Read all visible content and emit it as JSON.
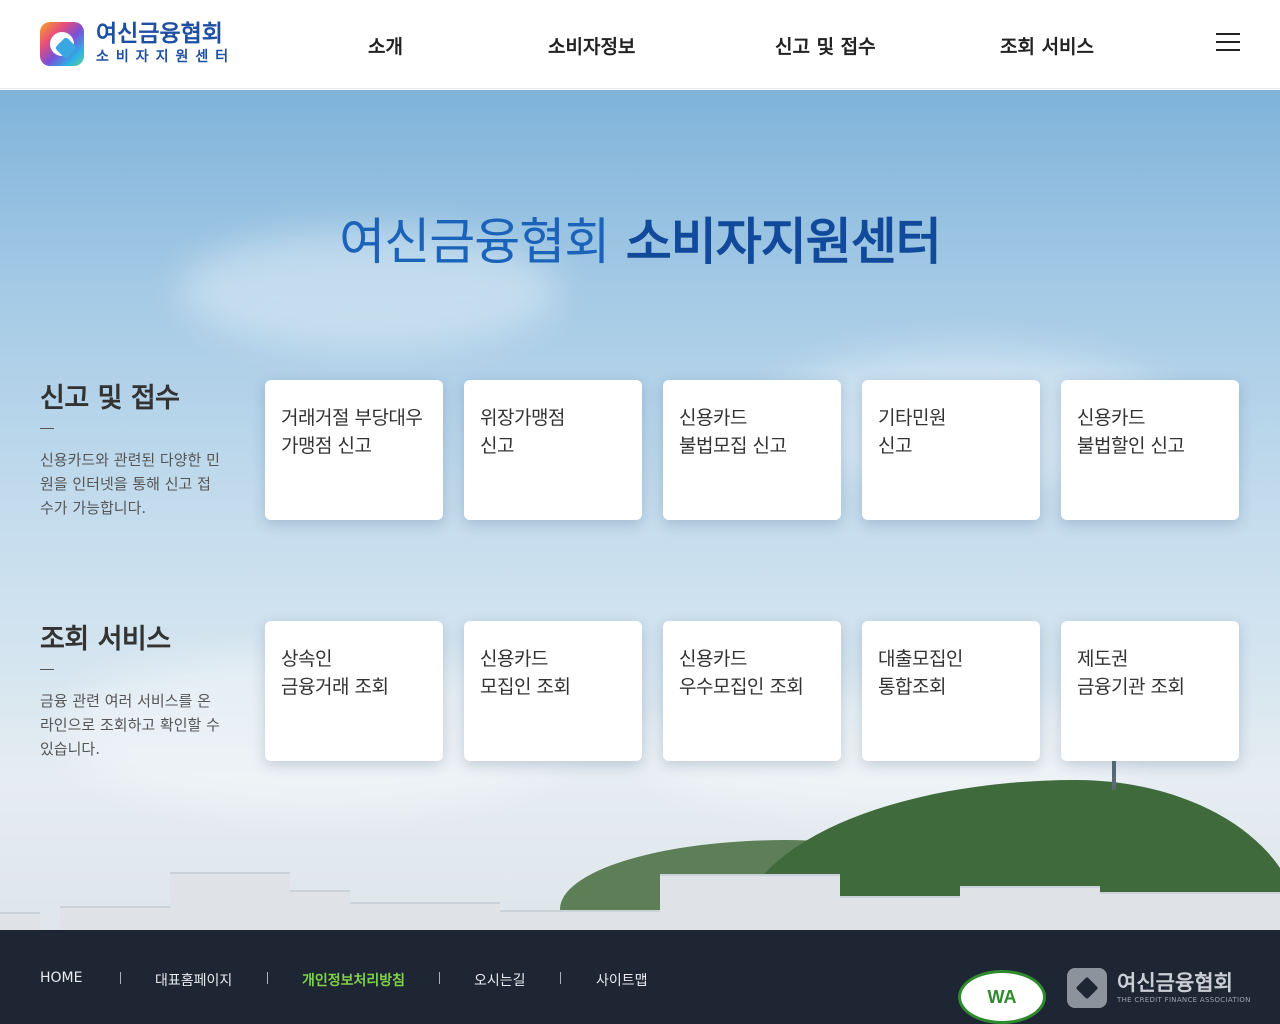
{
  "header": {
    "logo_title": "여신금융협회",
    "logo_sub": "소비자지원센터",
    "nav": [
      "소개",
      "소비자정보",
      "신고 및 접수",
      "조회 서비스"
    ]
  },
  "hero": {
    "title_light": "여신금융협회",
    "title_bold": "소비자지원센터"
  },
  "report": {
    "title": "신고 및 접수",
    "desc": "신용카드와 관련된 다양한 민원을 인터넷을 통해 신고 접수가 가능합니다.",
    "cards": [
      {
        "line1": "거래거절 부당대우",
        "line2": "가맹점 신고"
      },
      {
        "line1": "위장가맹점",
        "line2": "신고"
      },
      {
        "line1": "신용카드",
        "line2": "불법모집 신고"
      },
      {
        "line1": "기타민원",
        "line2": "신고"
      },
      {
        "line1": "신용카드",
        "line2": "불법할인 신고"
      }
    ]
  },
  "inquiry": {
    "title": "조회 서비스",
    "desc": "금융 관련 여러 서비스를 온라인으로 조회하고 확인할 수 있습니다.",
    "cards": [
      {
        "line1": "상속인",
        "line2": "금융거래 조회"
      },
      {
        "line1": "신용카드",
        "line2": "모집인 조회"
      },
      {
        "line1": "신용카드",
        "line2": "우수모집인 조회"
      },
      {
        "line1": "대출모집인",
        "line2": "통합조회"
      },
      {
        "line1": "제도권",
        "line2": "금융기관 조회"
      }
    ]
  },
  "footer": {
    "links": [
      "HOME",
      "대표홈페이지",
      "개인정보처리방침",
      "오시는길",
      "사이트맵"
    ],
    "wa_badge": "WA",
    "logo_title": "여신금융협회",
    "logo_sub": "THE CREDIT FINANCE ASSOCIATION"
  },
  "colors": {
    "brand_blue": "#1f4fa3",
    "footer_bg": "#1e2633",
    "active_link": "#7fd14a"
  },
  "icons": [
    "menu-icon",
    "logo-mark-icon",
    "wa-certification-icon"
  ]
}
